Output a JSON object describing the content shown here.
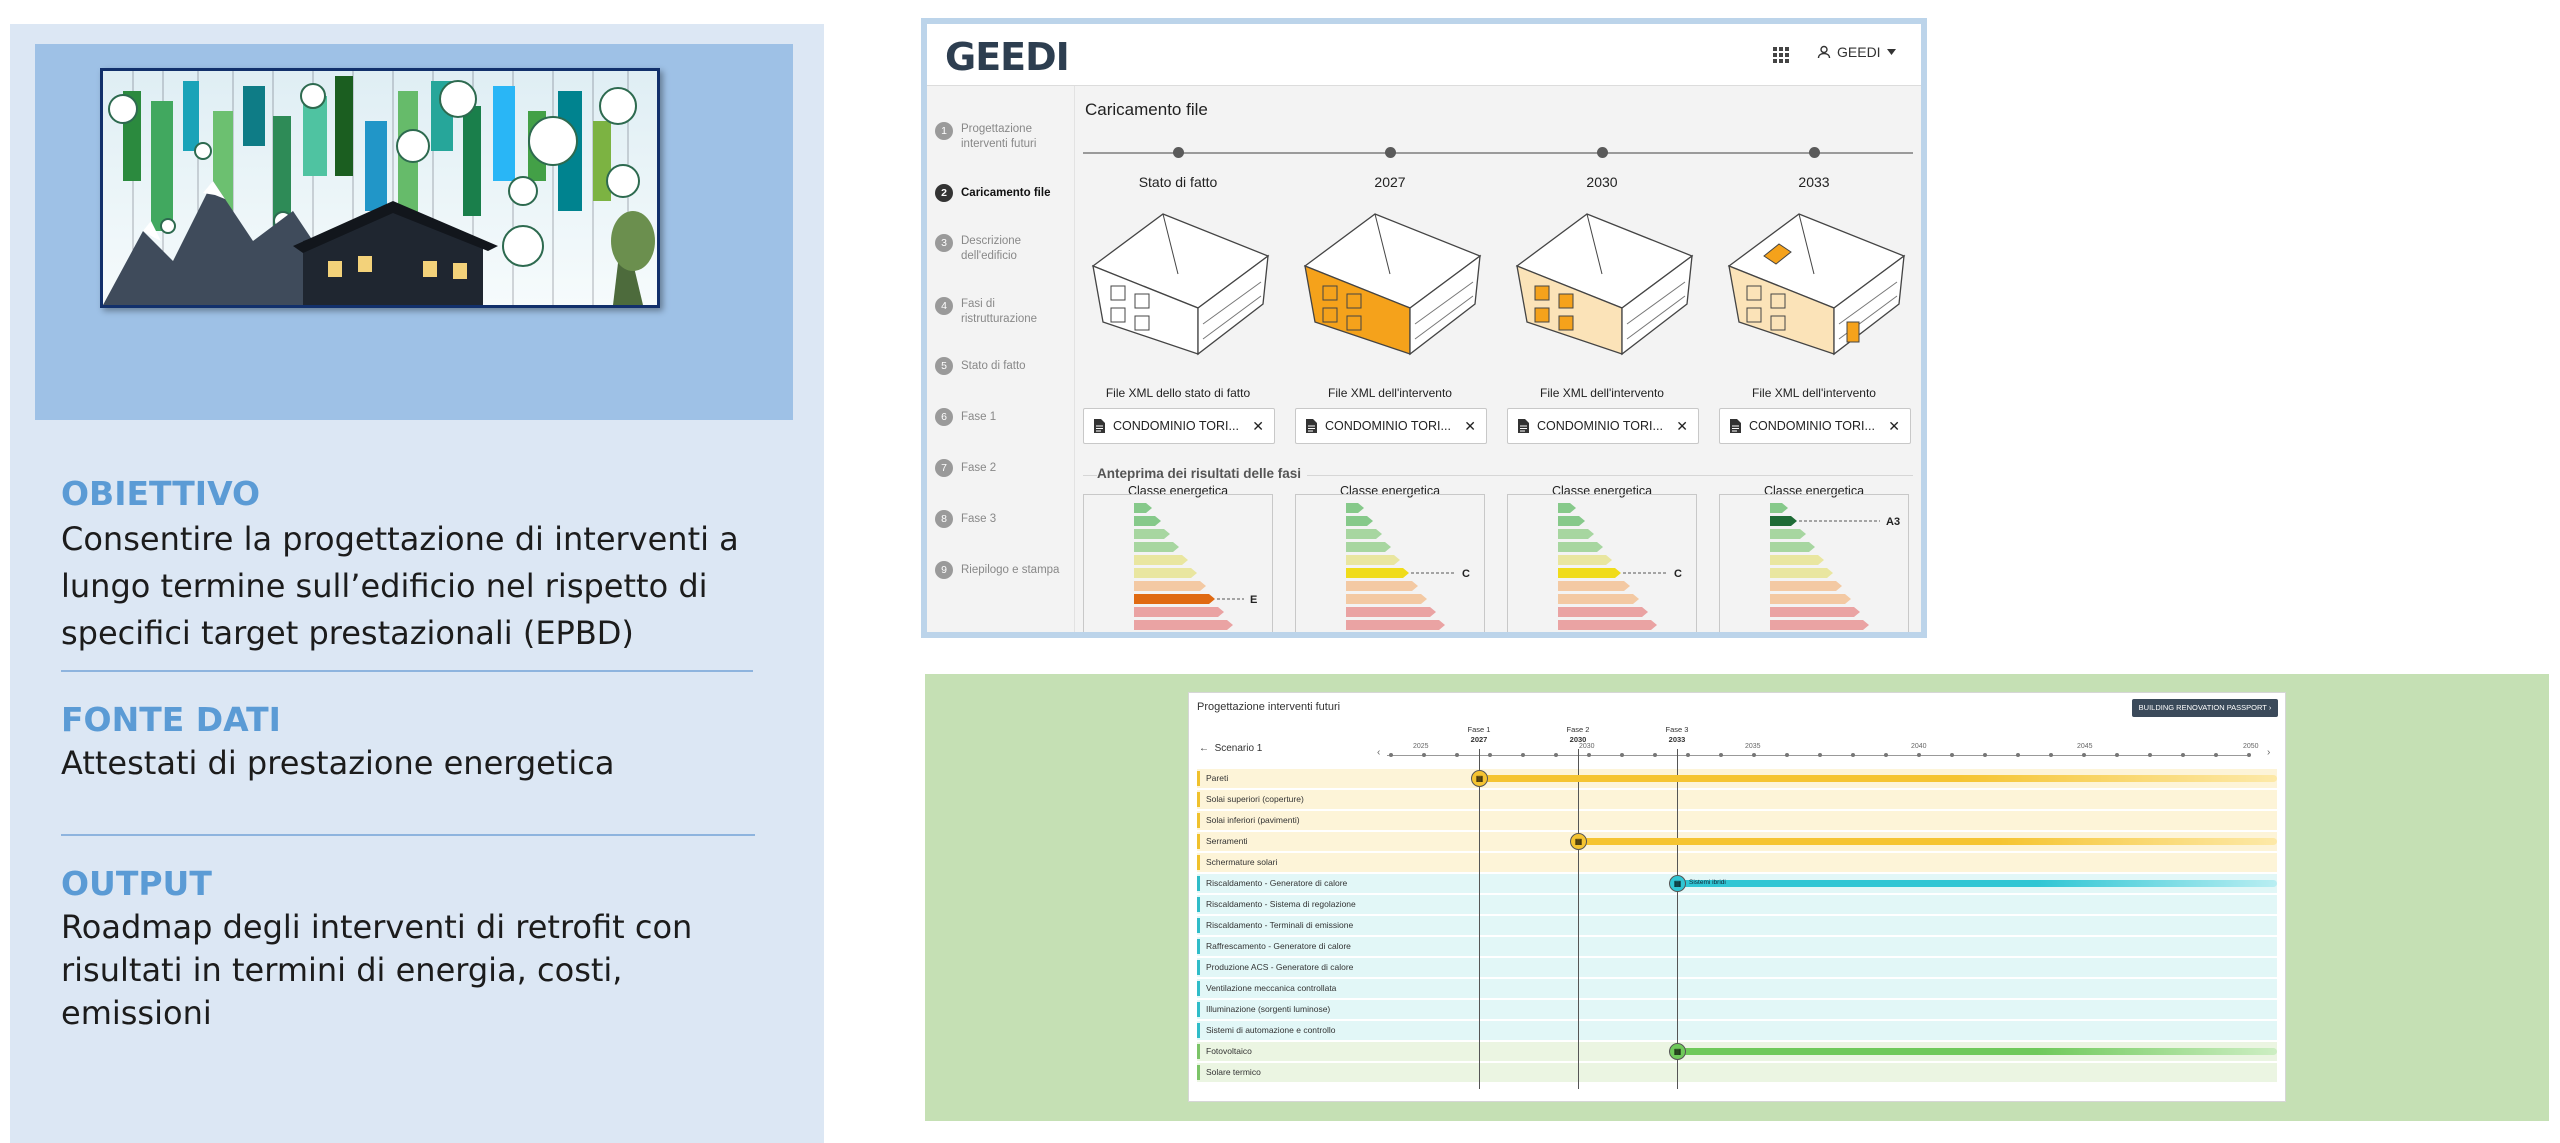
{
  "left": {
    "sections": [
      {
        "title": "OBIETTIVO",
        "lines": [
          "Consentire la progettazione di interventi a",
          "lungo termine sull’edificio nel rispetto di",
          "specifici target prestazionali (EPBD)"
        ]
      },
      {
        "title": "FONTE DATI",
        "lines": [
          "Attestati di prestazione energetica"
        ]
      },
      {
        "title": "OUTPUT",
        "lines": [
          "Roadmap degli interventi di retrofit con",
          "risultati in termini di energia, costi,",
          "emissioni"
        ]
      }
    ]
  },
  "app": {
    "logo": "GEEDI",
    "user_label": "GEEDI",
    "icons": {
      "apps": "grid-icon",
      "user": "user-icon",
      "caret": "caret-down-icon",
      "file": "file-icon",
      "close": "close-icon"
    },
    "steps": [
      {
        "num": "1",
        "label": "Progettazione interventi futuri"
      },
      {
        "num": "2",
        "label": "Caricamento file",
        "active": true
      },
      {
        "num": "3",
        "label": "Descrizione dell'edificio"
      },
      {
        "num": "4",
        "label": "Fasi di ristrutturazione"
      },
      {
        "num": "5",
        "label": "Stato di fatto"
      },
      {
        "num": "6",
        "label": "Fase 1"
      },
      {
        "num": "7",
        "label": "Fase 2"
      },
      {
        "num": "8",
        "label": "Fase 3"
      },
      {
        "num": "9",
        "label": "Riepilogo e stampa"
      }
    ],
    "content_title": "Caricamento file",
    "columns": [
      {
        "label": "Stato di fatto",
        "file_label": "File XML dello stato di fatto",
        "file_name": "CONDOMINIO TORI...",
        "energy_title": "Classe energetica",
        "energy_class": "E"
      },
      {
        "label": "2027",
        "file_label": "File XML dell'intervento",
        "file_name": "CONDOMINIO TORI...",
        "energy_title": "Classe energetica",
        "energy_class": "C"
      },
      {
        "label": "2030",
        "file_label": "File XML dell'intervento",
        "file_name": "CONDOMINIO TORI...",
        "energy_title": "Classe energetica",
        "energy_class": "C"
      },
      {
        "label": "2033",
        "file_label": "File XML dell'intervento",
        "file_name": "CONDOMINIO TORI...",
        "energy_title": "Classe energetica",
        "energy_class": "A3"
      }
    ],
    "preview_title": "Anteprima dei risultati delle fasi",
    "colors": {
      "accent": "#f5a21b",
      "dark": "#2d3e50"
    }
  },
  "roadmap": {
    "title": "Progettazione interventi futuri",
    "button": "BUILDING RENOVATION PASSPORT",
    "scenario": "Scenario 1",
    "phases": [
      {
        "name": "Fase 1",
        "year": "2027"
      },
      {
        "name": "Fase 2",
        "year": "2030"
      },
      {
        "name": "Fase 3",
        "year": "2033"
      }
    ],
    "years": [
      "2025",
      "2030",
      "2035",
      "2040",
      "2045",
      "2050"
    ],
    "rows": [
      {
        "label": "Pareti",
        "group": "env"
      },
      {
        "label": "Solai superiori (coperture)",
        "group": "env"
      },
      {
        "label": "Solai inferiori (pavimenti)",
        "group": "env"
      },
      {
        "label": "Serramenti",
        "group": "env"
      },
      {
        "label": "Schermature solari",
        "group": "env"
      },
      {
        "label": "Riscaldamento - Generatore di calore",
        "group": "sys"
      },
      {
        "label": "Riscaldamento - Sistema di regolazione",
        "group": "sys"
      },
      {
        "label": "Riscaldamento - Terminali di emissione",
        "group": "sys"
      },
      {
        "label": "Raffrescamento - Generatore di calore",
        "group": "sys"
      },
      {
        "label": "Produzione ACS - Generatore di calore",
        "group": "sys"
      },
      {
        "label": "Ventilazione meccanica controllata",
        "group": "sys"
      },
      {
        "label": "Illuminazione (sorgenti luminose)",
        "group": "sys"
      },
      {
        "label": "Sistemi di automazione e controllo",
        "group": "sys"
      },
      {
        "label": "Fotovoltaico",
        "group": "ren"
      },
      {
        "label": "Solare termico",
        "group": "ren"
      }
    ],
    "bar_label": "Sistemi ibridi"
  }
}
